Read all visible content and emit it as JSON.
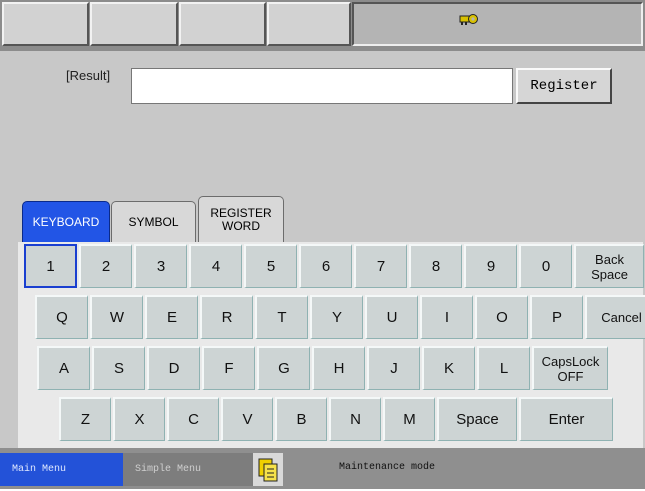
{
  "header": {
    "tabs": [
      "",
      "",
      "",
      ""
    ],
    "status_icon": "key-icon"
  },
  "result": {
    "label": "[Result]",
    "value": "",
    "register_label": "Register"
  },
  "tabs": {
    "keyboard": "KEYBOARD",
    "symbol": "SYMBOL",
    "register_word": "REGISTER\nWORD"
  },
  "keyboard": {
    "row1": [
      "1",
      "2",
      "3",
      "4",
      "5",
      "6",
      "7",
      "8",
      "9",
      "0",
      "Back\nSpace"
    ],
    "row2": [
      "Q",
      "W",
      "E",
      "R",
      "T",
      "Y",
      "U",
      "I",
      "O",
      "P",
      "Cancel"
    ],
    "row3": [
      "A",
      "S",
      "D",
      "F",
      "G",
      "H",
      "J",
      "K",
      "L",
      "CapsLock\nOFF"
    ],
    "row4": [
      "Z",
      "X",
      "C",
      "V",
      "B",
      "N",
      "M",
      "Space",
      "Enter"
    ]
  },
  "bottom": {
    "main_menu": "Main Menu",
    "simple_menu": "Simple Menu",
    "status": "Maintenance mode",
    "maint_icon": "clipboard-icon"
  },
  "colors": {
    "tab_active": "#2255e6",
    "main_menu": "#2352d8"
  }
}
